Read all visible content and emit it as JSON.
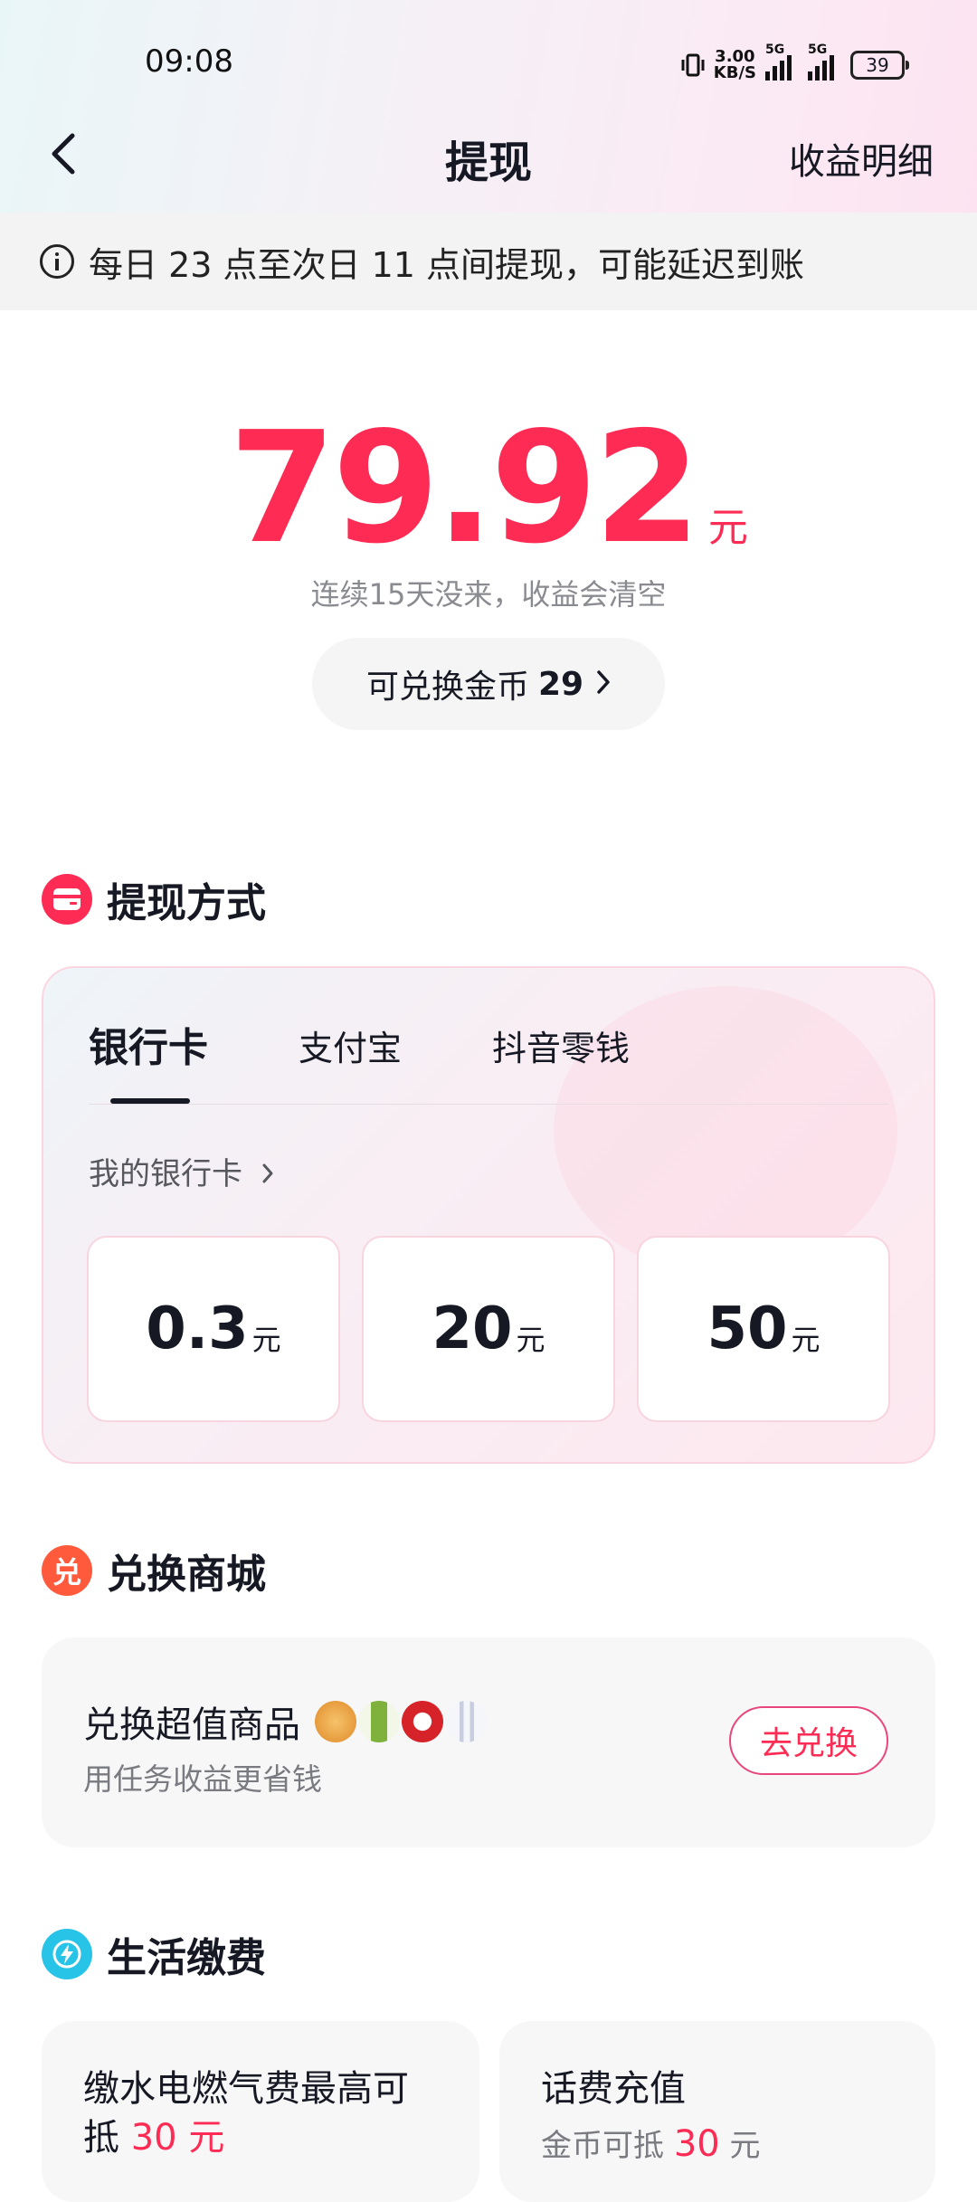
{
  "status_bar": {
    "time": "09:08",
    "speed_value": "3.00",
    "speed_unit": "KB/S",
    "net1": "5G",
    "net2": "5G",
    "battery": "39"
  },
  "header": {
    "title": "提现",
    "detail_link": "收益明细"
  },
  "notice": {
    "text": "每日 23 点至次日 11 点间提现，可能延迟到账"
  },
  "balance": {
    "amount": "79.92",
    "unit": "元",
    "warning": "连续15天没来，收益会清空"
  },
  "coins": {
    "label": "可兑换金币",
    "value": "29"
  },
  "withdraw": {
    "section_title": "提现方式",
    "tabs": [
      "银行卡",
      "支付宝",
      "抖音零钱"
    ],
    "my_card_link": "我的银行卡",
    "amounts": [
      {
        "value": "0.3",
        "unit": "元"
      },
      {
        "value": "20",
        "unit": "元"
      },
      {
        "value": "50",
        "unit": "元"
      }
    ]
  },
  "mall": {
    "section_title": "兑换商城",
    "badge": "兑",
    "title": "兑换超值商品",
    "subtitle": "用任务收益更省钱",
    "button": "去兑换"
  },
  "life": {
    "section_title": "生活缴费",
    "card1": {
      "title_prefix": "缴水电燃气费最高可",
      "title_line2_prefix": "抵",
      "highlight": "30 元"
    },
    "card2": {
      "title": "话费充值",
      "sub_prefix": "金币可抵",
      "highlight": "30",
      "sub_suffix": "元"
    }
  },
  "colors": {
    "accent": "#fe2c55",
    "mall_badge": "#ff5a3c",
    "life_badge": "#28c4e8"
  }
}
